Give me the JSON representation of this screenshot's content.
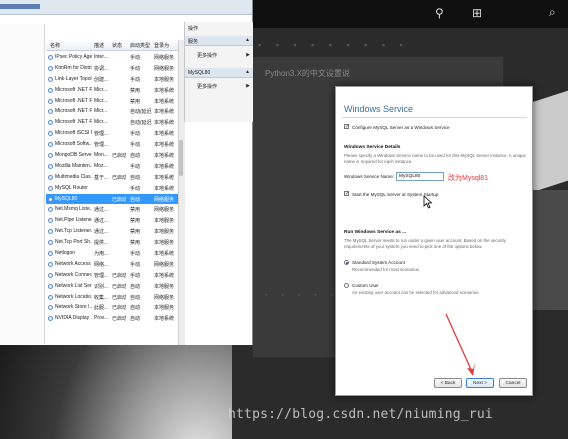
{
  "services": {
    "columns": [
      "名称",
      "描述",
      "状态",
      "启动类型",
      "登录为"
    ],
    "rows": [
      {
        "name": "IPsec Policy Agent",
        "desc": "Inter...",
        "status": "",
        "start": "手动",
        "logon": "网络服务"
      },
      {
        "name": "KtmRm for Distri...",
        "desc": "协调...",
        "status": "",
        "start": "手动",
        "logon": "网络服务"
      },
      {
        "name": "Link-Layer Topol...",
        "desc": "创建...",
        "status": "",
        "start": "手动",
        "logon": "本地服务"
      },
      {
        "name": "Microsoft .NET F...",
        "desc": "Micr...",
        "status": "",
        "start": "禁用",
        "logon": "本地系统"
      },
      {
        "name": "Microsoft .NET F...",
        "desc": "Micr...",
        "status": "",
        "start": "禁用",
        "logon": "本地系统"
      },
      {
        "name": "Microsoft .NET F...",
        "desc": "Micr...",
        "status": "",
        "start": "自动(延迟...",
        "logon": "本地系统"
      },
      {
        "name": "Microsoft .NET F...",
        "desc": "Micr...",
        "status": "",
        "start": "自动(延迟...",
        "logon": "本地系统"
      },
      {
        "name": "Microsoft iSCSI I...",
        "desc": "管理...",
        "status": "",
        "start": "手动",
        "logon": "本地系统"
      },
      {
        "name": "Microsoft Softw...",
        "desc": "管理...",
        "status": "",
        "start": "手动",
        "logon": "本地系统"
      },
      {
        "name": "MongoDB Server",
        "desc": "Mon...",
        "status": "已启动",
        "start": "自动",
        "logon": "本地系统"
      },
      {
        "name": "Mozilla Mainten...",
        "desc": "Moz...",
        "status": "",
        "start": "手动",
        "logon": "本地系统"
      },
      {
        "name": "Multimedia Clas...",
        "desc": "基于...",
        "status": "已启动",
        "start": "自动",
        "logon": "本地系统"
      },
      {
        "name": "MySQL Router",
        "desc": "",
        "status": "",
        "start": "手动",
        "logon": "本地系统"
      },
      {
        "name": "MySQL80",
        "desc": "",
        "status": "已启动",
        "start": "自动",
        "logon": "网络服务"
      },
      {
        "name": "Net.Msmq Liste...",
        "desc": "通过...",
        "status": "",
        "start": "禁用",
        "logon": "网络服务"
      },
      {
        "name": "Net.Pipe Listene...",
        "desc": "通过...",
        "status": "",
        "start": "禁用",
        "logon": "本地服务"
      },
      {
        "name": "Net.Tcp Listener...",
        "desc": "通过...",
        "status": "",
        "start": "禁用",
        "logon": "本地服务"
      },
      {
        "name": "Net.Tcp Port Sh...",
        "desc": "提供...",
        "status": "",
        "start": "禁用",
        "logon": "本地服务"
      },
      {
        "name": "Netlogon",
        "desc": "为用...",
        "status": "",
        "start": "手动",
        "logon": "本地系统"
      },
      {
        "name": "Network Access ...",
        "desc": "网络...",
        "status": "",
        "start": "手动",
        "logon": "网络服务"
      },
      {
        "name": "Network Connec...",
        "desc": "管理...",
        "status": "已启动",
        "start": "手动",
        "logon": "本地系统"
      },
      {
        "name": "Network List Ser...",
        "desc": "识别...",
        "status": "已启动",
        "start": "自动",
        "logon": "本地服务"
      },
      {
        "name": "Network Locatio...",
        "desc": "收集...",
        "status": "已启动",
        "start": "自动",
        "logon": "网络服务"
      },
      {
        "name": "Network Store I...",
        "desc": "此服...",
        "status": "已启动",
        "start": "自动",
        "logon": "本地服务"
      },
      {
        "name": "NVIDIA Display ...",
        "desc": "Prov...",
        "status": "已启动",
        "start": "自动",
        "logon": "本地系统"
      }
    ],
    "selected_index": 13
  },
  "ops_pane": {
    "header": "操作",
    "section1": "服务",
    "more1": "更多操作",
    "section2": "MySQL80",
    "more2": "更多操作"
  },
  "dialog": {
    "title": "Windows Service",
    "configure_label": "Configure MySQL Server as a Windows Service",
    "details_heading": "Windows Service Details",
    "details_text1": "Please specify a Windows Service name to be used for this MySQL Server instance. A unique",
    "details_text2": "name is required for each instance.",
    "name_label": "Windows Service Name:",
    "name_value": "MySQL80",
    "annotation": "改为Mysql81",
    "start_label": "Start the MySQL Server at System Startup",
    "run_heading": "Run Windows Service as ...",
    "run_text1": "The MySQL Server needs to run under a given user account. Based on the security",
    "run_text2": "requirements of your system you need to pick one of the options below.",
    "standard_label": "Standard System Account",
    "standard_desc": "Recommended for most scenarios.",
    "custom_label": "Custom User",
    "custom_desc": "An existing user account can be selected for advanced scenarios.",
    "back_label": "< Back",
    "next_label": "Next >",
    "cancel_label": "Cancel"
  },
  "editor": {
    "title": "Python3.X的中文设置说"
  },
  "watermark": "https://blog.csdn.net/niuming_rui",
  "colors": {
    "selection": "#3399ff",
    "dialog_title": "#3b6ea5",
    "annotation": "#e23b3b",
    "arrow": "#e23b3b"
  }
}
